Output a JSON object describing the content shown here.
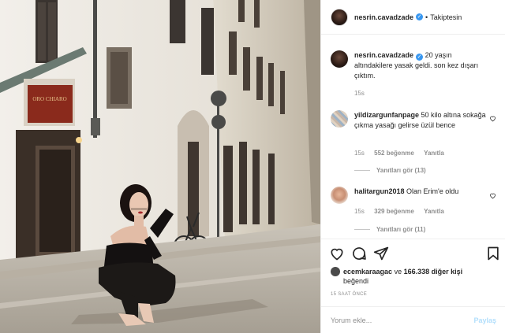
{
  "post": {
    "author": "nesrin.cavadzade",
    "follow_status": "Takiptesin",
    "caption": "20 yaşın altındakilere yasak geldi. son kez dışarı çıktım.",
    "caption_time": "15s"
  },
  "comments": [
    {
      "user": "yildizargunfanpage",
      "text": "50 kilo altına sokağa çıkma yasağı gelirse üzül bence",
      "time": "15s",
      "likes": "552 beğenme",
      "reply_label": "Yanıtla",
      "view_replies": "Yanıtları gör (13)"
    },
    {
      "user": "halitargun2018",
      "text": "Olan Erim'e oldu",
      "time": "15s",
      "likes": "329 beğenme",
      "reply_label": "Yanıtla",
      "view_replies": "Yanıtları gör (11)"
    }
  ],
  "likes_summary": {
    "first_user": "ecemkaraagac",
    "connector": "ve",
    "others": "166.338 diğer kişi",
    "suffix": "beğendi"
  },
  "timestamp": "15 SAAT ÖNCE",
  "comment_box": {
    "placeholder": "Yorum ekle...",
    "post_label": "Paylaş"
  },
  "photo": {
    "shop_sign": "ORO CHIARO"
  },
  "icons": [
    "heart-icon",
    "comment-icon",
    "share-icon",
    "bookmark-icon",
    "verified-icon",
    "like-comment-icon"
  ],
  "colors": {
    "verified": "#3897f0",
    "muted": "#8e8e8e",
    "text": "#262626",
    "post_disabled": "#b2dffc",
    "shop_sign": "#8a2a1c"
  }
}
